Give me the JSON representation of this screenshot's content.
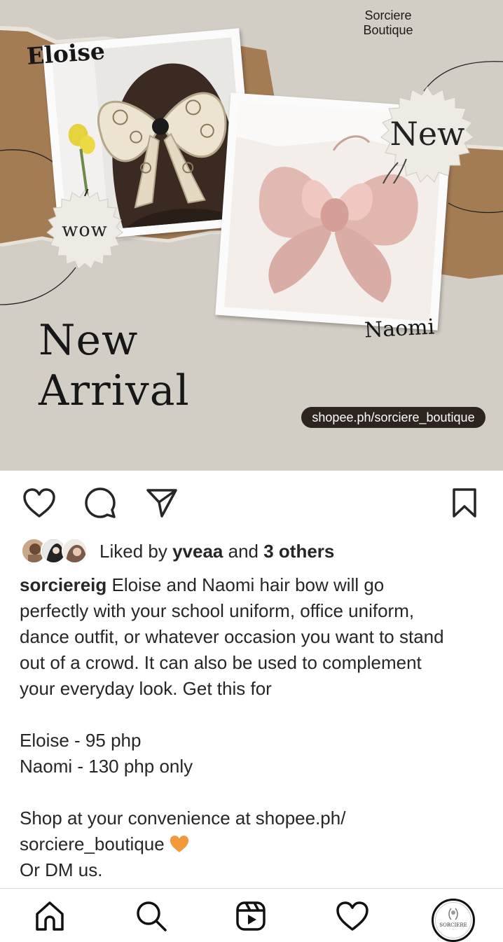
{
  "post_image": {
    "brand_line1": "Sorciere",
    "brand_line2": "Boutique",
    "label_eloise": "Eloise",
    "label_naomi": "Naomi",
    "badge_wow": "wow",
    "badge_new": "New",
    "headline_line1": "New",
    "headline_line2": "Arrival",
    "shop_url": "shopee.ph/sorciere_boutique"
  },
  "actions": {
    "like_icon": "heart-outline-icon",
    "comment_icon": "comment-bubble-icon",
    "share_icon": "paper-plane-icon",
    "save_icon": "bookmark-icon"
  },
  "likes": {
    "prefix": "Liked by ",
    "user": "yveaa",
    "middle": " and ",
    "others": "3 others"
  },
  "caption": {
    "username": "sorciereig",
    "line1": " Eloise and Naomi hair bow will go",
    "line2": "perfectly with your school uniform, office uniform,",
    "line3": "dance outfit, or whatever occasion you want to stand",
    "line4": "out of a crowd. It can also be used to complement",
    "line5": "your everyday look. Get this for",
    "price1": "Eloise - 95 php",
    "price2": "Naomi - 130 php only",
    "shop1": "Shop at your convenience at shopee.ph/",
    "shop2": "sorciere_boutique",
    "shop3": "Or DM us.",
    "emoji": "orange-heart-icon"
  },
  "bottom_nav": {
    "items": [
      "home-icon",
      "search-icon",
      "reels-icon",
      "activity-heart-icon",
      "profile-avatar"
    ],
    "profile_text": "SORCIERE"
  },
  "colors": {
    "background": "#d3cec5",
    "kraft": "#a57d55",
    "pill": "#2e241f",
    "bow_pink": "#e3bcb6",
    "emoji": "#f29a3b"
  }
}
